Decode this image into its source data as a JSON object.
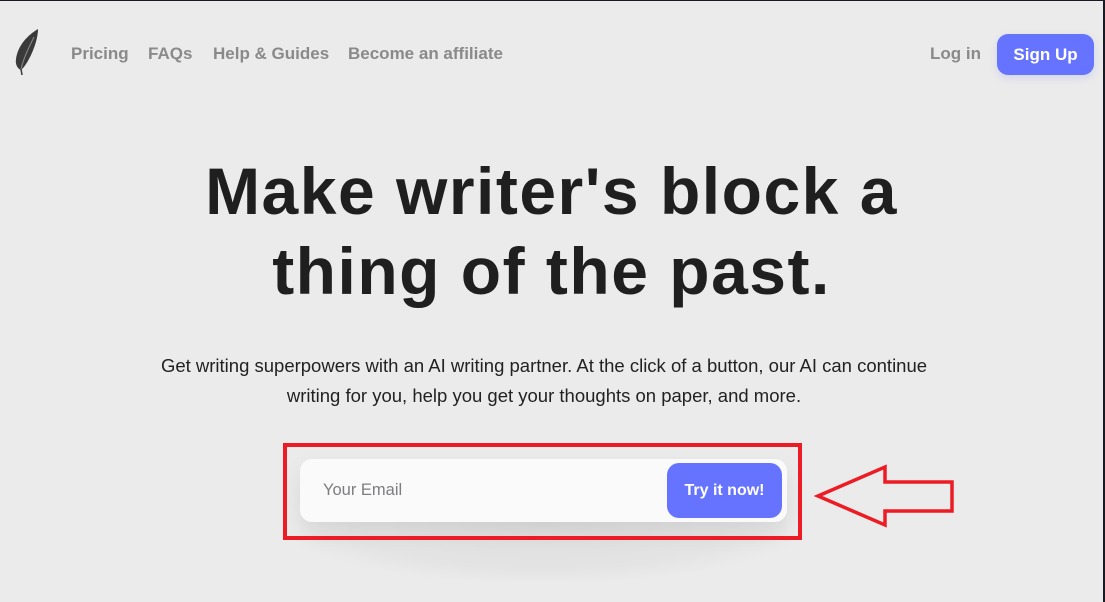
{
  "nav": {
    "logo_icon": "feather-icon",
    "links": [
      {
        "label": "Pricing"
      },
      {
        "label": "FAQs"
      },
      {
        "label": "Help & Guides"
      },
      {
        "label": "Become an affiliate"
      }
    ],
    "login_label": "Log in",
    "signup_label": "Sign Up"
  },
  "hero": {
    "headline_line1": "Make writer's block a",
    "headline_line2": "thing of the past.",
    "subtext_line1": "Get writing superpowers with an AI writing partner. At the click of a button, our AI can continue",
    "subtext_line2": "writing for you, help you get your thoughts on paper, and more."
  },
  "signup_form": {
    "email_placeholder": "Your Email",
    "email_value": "",
    "submit_label": "Try it now!"
  },
  "annotation": {
    "highlight_color": "#ed1c24",
    "arrow_direction": "left",
    "arrow_icon": "left-arrow-outline-icon"
  },
  "colors": {
    "accent": "#6673ff",
    "background": "#ebebeb",
    "headline": "#1f1f1f",
    "nav_text": "#8a8a8a"
  }
}
